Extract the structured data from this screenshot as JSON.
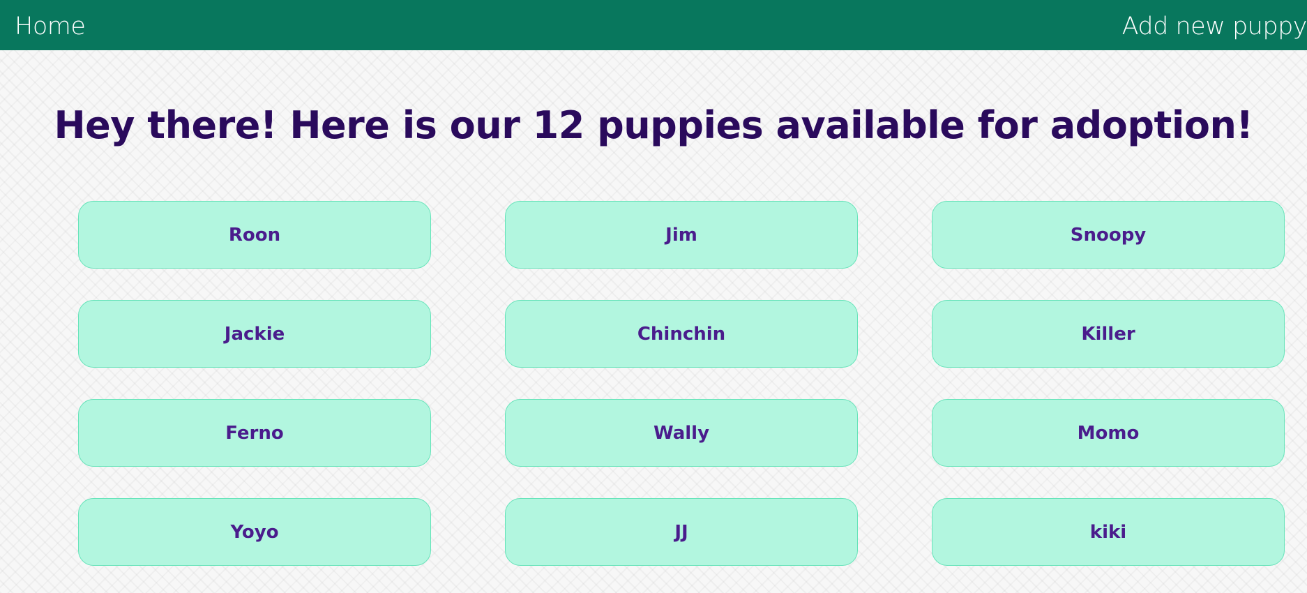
{
  "nav": {
    "home_label": "Home",
    "add_label": "Add new puppy"
  },
  "heading": "Hey there! Here is our 12 puppies available for adoption!",
  "puppies": [
    {
      "name": "Roon"
    },
    {
      "name": "Jim"
    },
    {
      "name": "Snoopy"
    },
    {
      "name": "Jackie"
    },
    {
      "name": "Chinchin"
    },
    {
      "name": "Killer"
    },
    {
      "name": "Ferno"
    },
    {
      "name": "Wally"
    },
    {
      "name": "Momo"
    },
    {
      "name": "Yoyo"
    },
    {
      "name": "JJ"
    },
    {
      "name": "kiki"
    }
  ],
  "colors": {
    "navbar": "#08775d",
    "heading": "#2a0a5c",
    "card_bg": "#b2f6df",
    "card_border": "#66e3b9",
    "card_text": "#4a1c8c"
  }
}
